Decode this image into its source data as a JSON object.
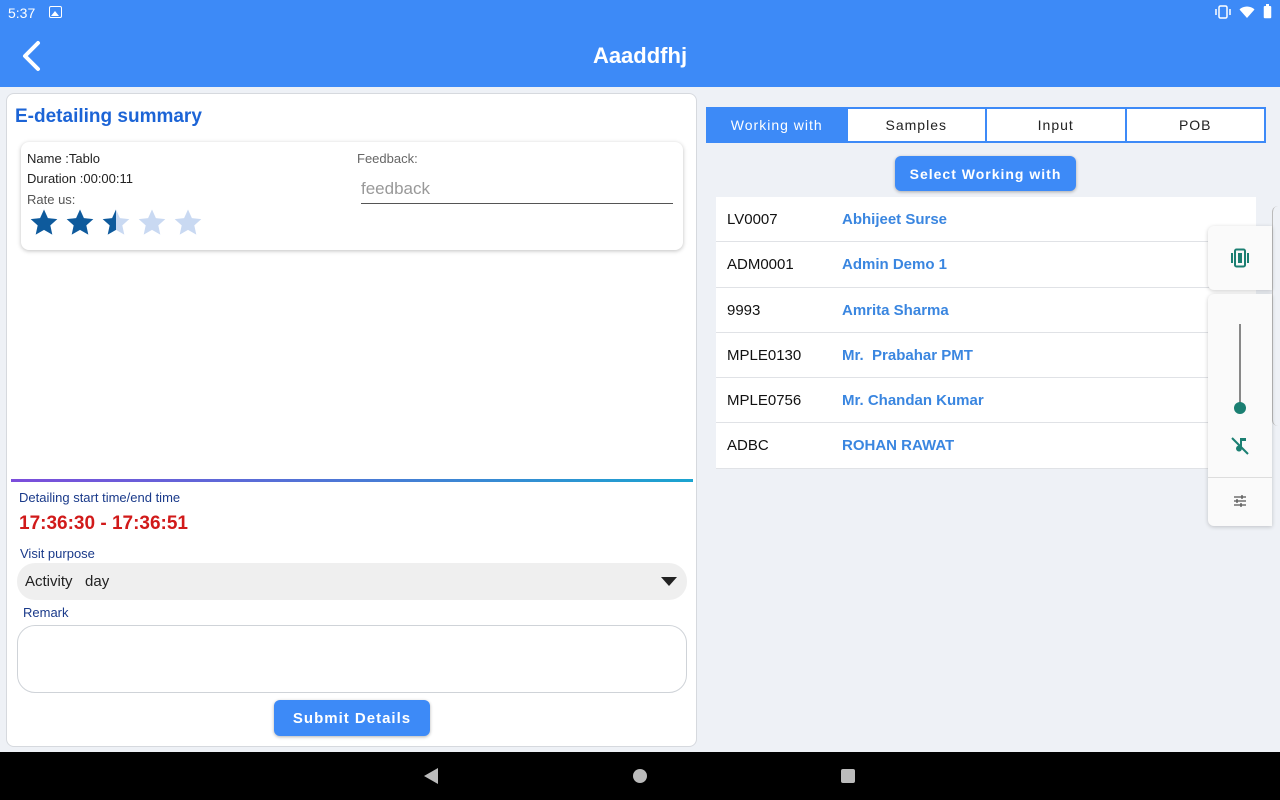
{
  "status_bar": {
    "time": "5:37"
  },
  "app_bar": {
    "title": "Aaaddfhj"
  },
  "summary": {
    "title": "E-detailing summary",
    "name_line": "Name :Tablo",
    "duration_line": "Duration :00:00:11",
    "rate_label": "Rate us:",
    "rating": 2.5,
    "max_rating": 5,
    "feedback_label": "Feedback:",
    "feedback_placeholder": "feedback",
    "feedback_value": ""
  },
  "detailing": {
    "time_label": "Detailing start time/end time",
    "time_range": "17:36:30 - 17:36:51",
    "visit_purpose_label": "Visit purpose",
    "visit_purpose_value": "Activity   day",
    "remark_label": "Remark",
    "remark_value": "",
    "submit_label": "Submit Details"
  },
  "tabs": [
    {
      "label": "Working with",
      "active": true
    },
    {
      "label": "Samples",
      "active": false
    },
    {
      "label": "Input",
      "active": false
    },
    {
      "label": "POB",
      "active": false
    }
  ],
  "select_button_label": "Select Working with",
  "working_with": [
    {
      "code": "LV0007",
      "name": "Abhijeet Surse"
    },
    {
      "code": "ADM0001",
      "name": "Admin Demo 1"
    },
    {
      "code": "9993",
      "name": "Amrita Sharma"
    },
    {
      "code": "MPLE0130",
      "name": "Mr.  Prabahar PMT"
    },
    {
      "code": "MPLE0756",
      "name": "Mr. Chandan Kumar"
    },
    {
      "code": "ADBC",
      "name": "ROHAN RAWAT"
    }
  ],
  "volume_panel": {
    "level": 0.1
  },
  "colors": {
    "primary": "#3d8af7",
    "title_blue": "#1c64d6",
    "time_red": "#d11a1a",
    "link_blue": "#3a86e0",
    "star_filled": "#0e5a9c",
    "star_empty": "#c9d9f2",
    "volume_accent": "#1b7f72"
  }
}
